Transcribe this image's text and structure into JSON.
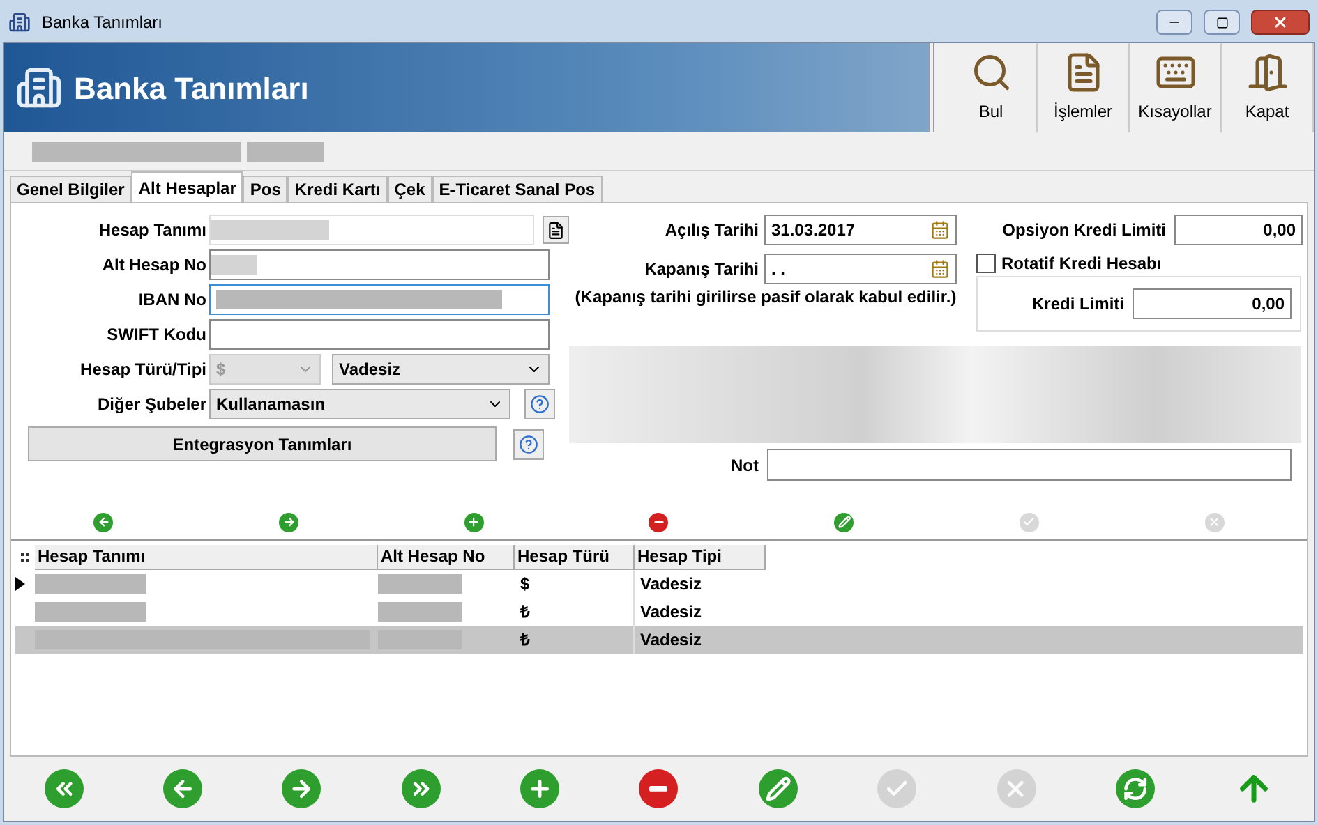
{
  "window": {
    "title": "Banka Tanımları"
  },
  "header": {
    "title": "Banka Tanımları",
    "tools": [
      {
        "kind": "search",
        "label": "Bul"
      },
      {
        "kind": "edit",
        "label": "İşlemler"
      },
      {
        "kind": "keyboard",
        "label": "Kısayollar"
      },
      {
        "kind": "exit",
        "label": "Kapat"
      }
    ]
  },
  "tabs": [
    {
      "label": "Genel Bilgiler",
      "selected": false
    },
    {
      "label": "Alt Hesaplar",
      "selected": true
    },
    {
      "label": "Pos",
      "selected": false
    },
    {
      "label": "Kredi Kartı",
      "selected": false
    },
    {
      "label": "Çek",
      "selected": false
    },
    {
      "label": "E-Ticaret Sanal Pos",
      "selected": false
    }
  ],
  "form": {
    "hesap_tanimi": {
      "label": "Hesap Tanımı"
    },
    "alt_hesap_no": {
      "label": "Alt Hesap No"
    },
    "iban_no": {
      "label": "IBAN No"
    },
    "swift_kodu": {
      "label": "SWIFT Kodu"
    },
    "hesap_turu_tipi": {
      "label": "Hesap Türü/Tipi",
      "turu": "$",
      "tipi": "Vadesiz"
    },
    "diger_subeler": {
      "label": "Diğer Şubeler",
      "value": "Kullanamasın"
    },
    "entegrasyon_button": "Entegrasyon Tanımları",
    "acilis_tarihi": {
      "label": "Açılış Tarihi",
      "value": "31.03.2017"
    },
    "kapanis_tarihi": {
      "label": "Kapanış Tarihi",
      "value": ". ."
    },
    "kapanis_note": "(Kapanış tarihi girilirse pasif olarak kabul edilir.)",
    "opsiyon_kredi_limiti": {
      "label": "Opsiyon Kredi Limiti",
      "value": "0,00"
    },
    "rotatif_kredi_hesabi": {
      "label": "Rotatif Kredi Hesabı",
      "checked": false
    },
    "kredi_limiti": {
      "label": "Kredi Limiti",
      "value": "0,00"
    },
    "not": {
      "label": "Not"
    }
  },
  "grid_toolbar": [
    {
      "kind": "prev",
      "disabled": false
    },
    {
      "kind": "next",
      "disabled": false
    },
    {
      "kind": "add",
      "disabled": false
    },
    {
      "kind": "delete",
      "disabled": false
    },
    {
      "kind": "edit",
      "disabled": false
    },
    {
      "kind": "confirm",
      "disabled": true
    },
    {
      "kind": "cancel",
      "disabled": true
    }
  ],
  "table": {
    "columns": [
      "Hesap Tanımı",
      "Alt Hesap No",
      "Hesap Türü",
      "Hesap Tipi"
    ],
    "rows": [
      {
        "hesap_turu": "$",
        "hesap_tipi": "Vadesiz",
        "current": true,
        "selected": false
      },
      {
        "hesap_turu": "₺",
        "hesap_tipi": "Vadesiz",
        "current": false,
        "selected": false
      },
      {
        "hesap_turu": "₺",
        "hesap_tipi": "Vadesiz",
        "current": false,
        "selected": true
      }
    ]
  },
  "bottom_toolbar": [
    {
      "kind": "first",
      "disabled": false
    },
    {
      "kind": "prev",
      "disabled": false
    },
    {
      "kind": "next",
      "disabled": false
    },
    {
      "kind": "last",
      "disabled": false
    },
    {
      "kind": "add",
      "disabled": false
    },
    {
      "kind": "delete",
      "disabled": false
    },
    {
      "kind": "edit",
      "disabled": false
    },
    {
      "kind": "confirm",
      "disabled": true
    },
    {
      "kind": "cancel",
      "disabled": true
    },
    {
      "kind": "refresh",
      "disabled": false
    },
    {
      "kind": "up",
      "disabled": false
    }
  ]
}
